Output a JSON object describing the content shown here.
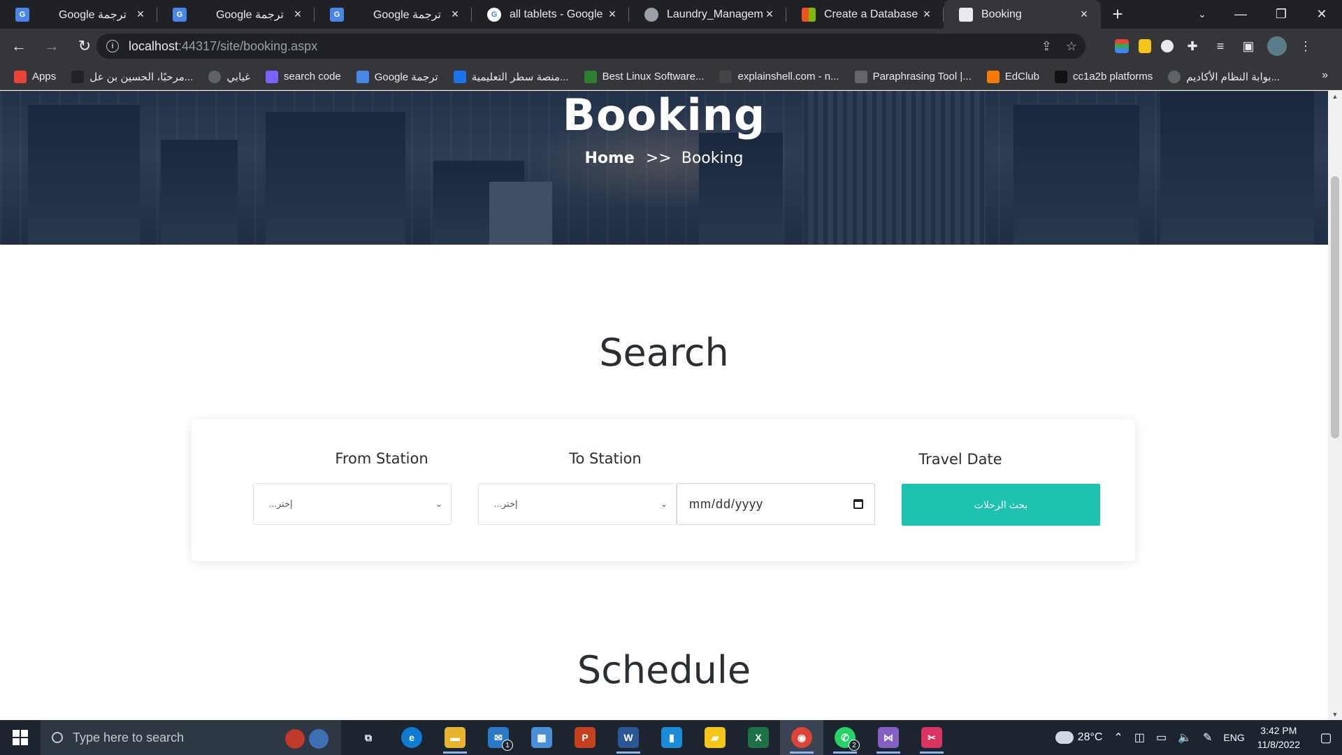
{
  "browser": {
    "tabs": [
      {
        "title": "Google ترجمة",
        "icon": "google-translate-icon",
        "color": "#4a86e8",
        "active": false
      },
      {
        "title": "Google ترجمة",
        "icon": "google-translate-icon",
        "color": "#4a86e8",
        "active": false
      },
      {
        "title": "Google ترجمة",
        "icon": "google-translate-icon",
        "color": "#4a86e8",
        "active": false
      },
      {
        "title": "all tablets - Google Se",
        "icon": "google-icon",
        "color": "#ffffff",
        "active": false
      },
      {
        "title": "Laundry_Managemen",
        "icon": "globe-icon",
        "color": "#9aa0a6",
        "active": false
      },
      {
        "title": "Create a Database - S",
        "icon": "microsoft-icon",
        "color": "#f25022",
        "active": false
      },
      {
        "title": "Booking",
        "icon": "page-icon",
        "color": "#e8eaed",
        "active": true
      }
    ],
    "new_tab": "+",
    "url_host": "localhost",
    "url_path": ":44317/site/booking.aspx",
    "bookmarks": [
      {
        "label": "Apps",
        "icon": "apps-grid-icon",
        "color": "#ea4335"
      },
      {
        "label": "مرحبًا، الحسين بن عل...",
        "icon": "blackboard-icon",
        "color": "#222222"
      },
      {
        "label": "غيابي",
        "icon": "globe-icon",
        "color": "#5f6368"
      },
      {
        "label": "search code",
        "icon": "search-code-icon",
        "color": "#7b61ff"
      },
      {
        "label": "Google ترجمة",
        "icon": "google-translate-icon",
        "color": "#4a86e8"
      },
      {
        "label": "منصة سطر التعليمية...",
        "icon": "platform-icon",
        "color": "#1a73e8"
      },
      {
        "label": "Best Linux Software...",
        "icon": "linux-icon",
        "color": "#2e7d32"
      },
      {
        "label": "explainshell.com - n...",
        "icon": "shell-icon",
        "color": "#444444"
      },
      {
        "label": "Paraphrasing Tool |...",
        "icon": "quill-icon",
        "color": "#666666"
      },
      {
        "label": "EdClub",
        "icon": "edclub-icon",
        "color": "#f57c00"
      },
      {
        "label": "cc1a2b platforms",
        "icon": "cc-icon",
        "color": "#111111"
      },
      {
        "label": "بوابة النظام الأكاديم...",
        "icon": "globe-icon",
        "color": "#5f6368"
      }
    ]
  },
  "hero": {
    "title": "Booking",
    "breadcrumb_home": "Home",
    "breadcrumb_sep": ">>",
    "breadcrumb_current": "Booking"
  },
  "search": {
    "title": "Search",
    "from_label": "From Station",
    "to_label": "To Station",
    "date_label": "Travel Date",
    "from_value": "...إختر",
    "to_value": "...إختر",
    "date_placeholder": "mm/dd/yyyy",
    "submit_label": "بحث الرحلات",
    "accent_color": "#1fc1b0"
  },
  "schedule": {
    "title": "Schedule"
  },
  "taskbar": {
    "search_placeholder": "Type here to search",
    "apps": [
      {
        "name": "task-view-icon",
        "glyph": "⧉",
        "color": "#1c2430",
        "running": false,
        "badge": ""
      },
      {
        "name": "edge-icon",
        "glyph": "e",
        "color": "#0f7bd1",
        "running": false,
        "badge": ""
      },
      {
        "name": "file-explorer-icon",
        "glyph": "▬",
        "color": "#e8b430",
        "running": true,
        "badge": ""
      },
      {
        "name": "mail-icon",
        "glyph": "✉",
        "color": "#2a78c8",
        "running": false,
        "badge": "1"
      },
      {
        "name": "store-icon",
        "glyph": "▦",
        "color": "#4a8fd6",
        "running": false,
        "badge": ""
      },
      {
        "name": "powerpoint-icon",
        "glyph": "P",
        "color": "#c4401f",
        "running": false,
        "badge": ""
      },
      {
        "name": "word-icon",
        "glyph": "W",
        "color": "#2b5797",
        "running": true,
        "badge": ""
      },
      {
        "name": "terminal-icon",
        "glyph": "▮",
        "color": "#1a8cd8",
        "running": false,
        "badge": ""
      },
      {
        "name": "sticky-notes-icon",
        "glyph": "▰",
        "color": "#f5c518",
        "running": false,
        "badge": ""
      },
      {
        "name": "excel-icon",
        "glyph": "X",
        "color": "#1e7145",
        "running": false,
        "badge": ""
      },
      {
        "name": "chrome-icon",
        "glyph": "◉",
        "color": "#db4437",
        "running": true,
        "badge": ""
      },
      {
        "name": "whatsapp-icon",
        "glyph": "✆",
        "color": "#25d366",
        "running": true,
        "badge": "2"
      },
      {
        "name": "visual-studio-icon",
        "glyph": "⋈",
        "color": "#865fc5",
        "running": true,
        "badge": ""
      },
      {
        "name": "snipping-tool-icon",
        "glyph": "✂",
        "color": "#d8345f",
        "running": true,
        "badge": ""
      }
    ],
    "weather": "28°C",
    "language": "ENG",
    "time": "3:42 PM",
    "date": "11/8/2022"
  }
}
